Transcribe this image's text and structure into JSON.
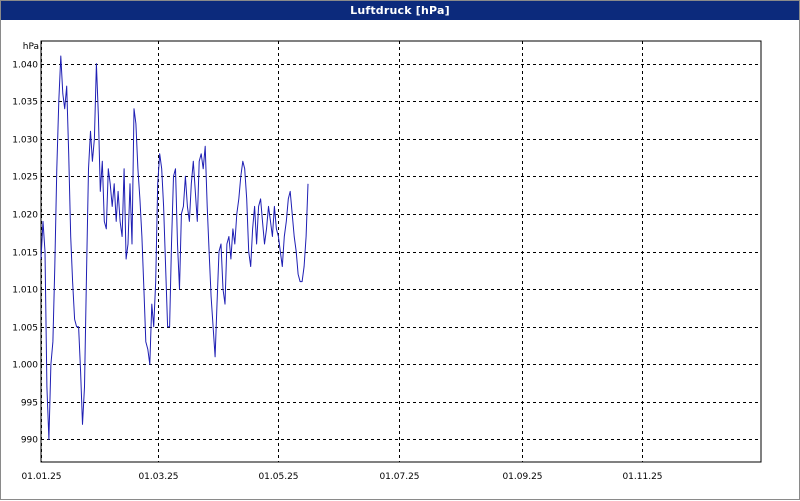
{
  "window": {
    "title": "Luftdruck [hPa]"
  },
  "colors": {
    "titlebar": "#0c2a7c",
    "line": "#1f1fb4",
    "grid": "#000000"
  },
  "chart_data": {
    "type": "line",
    "title": "Luftdruck [hPa]",
    "ylabel": "hPa",
    "xlabel": "",
    "grid": true,
    "ylim": [
      987,
      1043
    ],
    "xlim": [
      "01.01.25",
      "31.12.25"
    ],
    "x_ticks": [
      "01.01.25",
      "01.03.25",
      "01.05.25",
      "01.07.25",
      "01.09.25",
      "01.11.25"
    ],
    "y_ticks": [
      {
        "value": 990,
        "label": "990"
      },
      {
        "value": 995,
        "label": "995"
      },
      {
        "value": 1000,
        "label": "1.000"
      },
      {
        "value": 1005,
        "label": "1.005"
      },
      {
        "value": 1010,
        "label": "1.010"
      },
      {
        "value": 1015,
        "label": "1.015"
      },
      {
        "value": 1020,
        "label": "1.020"
      },
      {
        "value": 1025,
        "label": "1.025"
      },
      {
        "value": 1030,
        "label": "1.030"
      },
      {
        "value": 1035,
        "label": "1.035"
      },
      {
        "value": 1040,
        "label": "1.040"
      }
    ],
    "series": [
      {
        "values": [
          [
            "01.01.25",
            1014
          ],
          [
            "02.01.25",
            1019
          ],
          [
            "03.01.25",
            1015
          ],
          [
            "04.01.25",
            997
          ],
          [
            "05.01.25",
            990
          ],
          [
            "06.01.25",
            1000
          ],
          [
            "07.01.25",
            1003
          ],
          [
            "08.01.25",
            1013
          ],
          [
            "09.01.25",
            1026
          ],
          [
            "10.01.25",
            1035
          ],
          [
            "11.01.25",
            1041
          ],
          [
            "12.01.25",
            1036
          ],
          [
            "13.01.25",
            1034
          ],
          [
            "14.01.25",
            1037
          ],
          [
            "15.01.25",
            1028
          ],
          [
            "16.01.25",
            1017
          ],
          [
            "17.01.25",
            1011
          ],
          [
            "18.01.25",
            1006
          ],
          [
            "19.01.25",
            1005
          ],
          [
            "20.01.25",
            1005
          ],
          [
            "21.01.25",
            999
          ],
          [
            "22.01.25",
            992
          ],
          [
            "23.01.25",
            997
          ],
          [
            "24.01.25",
            1012
          ],
          [
            "25.01.25",
            1026
          ],
          [
            "26.01.25",
            1031
          ],
          [
            "27.01.25",
            1027
          ],
          [
            "28.01.25",
            1030
          ],
          [
            "29.01.25",
            1040
          ],
          [
            "30.01.25",
            1033
          ],
          [
            "31.01.25",
            1023
          ],
          [
            "01.02.25",
            1027
          ],
          [
            "02.02.25",
            1019
          ],
          [
            "03.02.25",
            1018
          ],
          [
            "04.02.25",
            1026
          ],
          [
            "05.02.25",
            1024
          ],
          [
            "06.02.25",
            1021
          ],
          [
            "07.02.25",
            1024
          ],
          [
            "08.02.25",
            1019
          ],
          [
            "09.02.25",
            1023
          ],
          [
            "10.02.25",
            1019
          ],
          [
            "11.02.25",
            1017
          ],
          [
            "12.02.25",
            1026
          ],
          [
            "13.02.25",
            1014
          ],
          [
            "14.02.25",
            1016
          ],
          [
            "15.02.25",
            1024
          ],
          [
            "16.02.25",
            1016
          ],
          [
            "17.02.25",
            1034
          ],
          [
            "18.02.25",
            1032
          ],
          [
            "19.02.25",
            1026
          ],
          [
            "20.02.25",
            1022
          ],
          [
            "21.02.25",
            1017
          ],
          [
            "22.02.25",
            1010
          ],
          [
            "23.02.25",
            1003
          ],
          [
            "24.02.25",
            1002
          ],
          [
            "25.02.25",
            1000
          ],
          [
            "26.02.25",
            1008
          ],
          [
            "27.02.25",
            1005
          ],
          [
            "28.02.25",
            1011
          ],
          [
            "01.03.25",
            1024
          ],
          [
            "02.03.25",
            1028
          ],
          [
            "03.03.25",
            1026
          ],
          [
            "04.03.25",
            1021
          ],
          [
            "05.03.25",
            1013
          ],
          [
            "06.03.25",
            1005
          ],
          [
            "07.03.25",
            1005
          ],
          [
            "08.03.25",
            1016
          ],
          [
            "09.03.25",
            1025
          ],
          [
            "10.03.25",
            1026
          ],
          [
            "11.03.25",
            1016
          ],
          [
            "12.03.25",
            1010
          ],
          [
            "13.03.25",
            1020
          ],
          [
            "14.03.25",
            1021
          ],
          [
            "15.03.25",
            1025
          ],
          [
            "16.03.25",
            1021
          ],
          [
            "17.03.25",
            1019
          ],
          [
            "18.03.25",
            1024
          ],
          [
            "19.03.25",
            1027
          ],
          [
            "20.03.25",
            1023
          ],
          [
            "21.03.25",
            1019
          ],
          [
            "22.03.25",
            1027
          ],
          [
            "23.03.25",
            1028
          ],
          [
            "24.03.25",
            1026
          ],
          [
            "25.03.25",
            1029
          ],
          [
            "26.03.25",
            1021
          ],
          [
            "27.03.25",
            1015
          ],
          [
            "28.03.25",
            1009
          ],
          [
            "29.03.25",
            1005
          ],
          [
            "30.03.25",
            1001
          ],
          [
            "31.03.25",
            1008
          ],
          [
            "01.04.25",
            1015
          ],
          [
            "02.04.25",
            1016
          ],
          [
            "03.04.25",
            1010
          ],
          [
            "04.04.25",
            1008
          ],
          [
            "05.04.25",
            1016
          ],
          [
            "06.04.25",
            1017
          ],
          [
            "07.04.25",
            1014
          ],
          [
            "08.04.25",
            1018
          ],
          [
            "09.04.25",
            1016
          ],
          [
            "10.04.25",
            1020
          ],
          [
            "11.04.25",
            1022
          ],
          [
            "12.04.25",
            1025
          ],
          [
            "13.04.25",
            1027
          ],
          [
            "14.04.25",
            1026
          ],
          [
            "15.04.25",
            1022
          ],
          [
            "16.04.25",
            1015
          ],
          [
            "17.04.25",
            1013
          ],
          [
            "18.04.25",
            1018
          ],
          [
            "19.04.25",
            1021
          ],
          [
            "20.04.25",
            1016
          ],
          [
            "21.04.25",
            1021
          ],
          [
            "22.04.25",
            1022
          ],
          [
            "23.04.25",
            1019
          ],
          [
            "24.04.25",
            1016
          ],
          [
            "25.04.25",
            1018
          ],
          [
            "26.04.25",
            1021
          ],
          [
            "27.04.25",
            1019
          ],
          [
            "28.04.25",
            1017
          ],
          [
            "29.04.25",
            1021
          ],
          [
            "30.04.25",
            1018
          ],
          [
            "01.05.25",
            1017
          ],
          [
            "02.05.25",
            1015
          ],
          [
            "03.05.25",
            1013
          ],
          [
            "04.05.25",
            1017
          ],
          [
            "05.05.25",
            1019
          ],
          [
            "06.05.25",
            1022
          ],
          [
            "07.05.25",
            1023
          ],
          [
            "08.05.25",
            1020
          ],
          [
            "09.05.25",
            1017
          ],
          [
            "10.05.25",
            1015
          ],
          [
            "11.05.25",
            1012
          ],
          [
            "12.05.25",
            1011
          ],
          [
            "13.05.25",
            1011
          ],
          [
            "14.05.25",
            1013
          ],
          [
            "15.05.25",
            1017
          ],
          [
            "16.05.25",
            1024
          ]
        ]
      }
    ]
  }
}
